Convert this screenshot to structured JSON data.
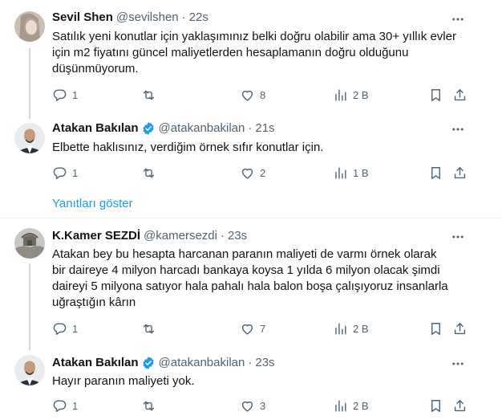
{
  "tweets": [
    {
      "name": "Sevil Shen",
      "handle": "@sevilshen",
      "separator": "·",
      "time": "22s",
      "verified": false,
      "lines": [
        "Satılık yeni konutlar için yaklaşımınız belki doğru olabilir ama 30+ yıllık evler",
        "için m2 fiyatını güncel maliyetlerden hesaplamanın doğru olduğunu",
        "düşünmüyorum."
      ],
      "replies": "1",
      "retweets": "",
      "likes": "8",
      "views": "2 B"
    },
    {
      "name": "Atakan Bakılan",
      "handle": "@atakanbakilan",
      "separator": "·",
      "time": "21s",
      "verified": true,
      "lines": [
        "Elbette haklısınız, verdiğim örnek sıfır konutlar için."
      ],
      "replies": "1",
      "retweets": "",
      "likes": "2",
      "views": "1 B"
    },
    {
      "name": "K.Kamer SEZDİ",
      "handle": "@kamersezdi",
      "separator": "·",
      "time": "23s",
      "verified": false,
      "lines": [
        "Atakan bey bu  hesapta harcanan paranın  maliyeti de varmı örnek olarak",
        "bir daireye 4 milyon harcadı bankaya koysa 1 yılda 6 milyon olacak şimdi",
        "daireyi 5 milyona satıyor hala pahalı hala balon boşa çalışıyoruz insanlarla",
        "uğraştığın kârın"
      ],
      "replies": "1",
      "retweets": "",
      "likes": "7",
      "views": "2 B"
    },
    {
      "name": "Atakan Bakılan",
      "handle": "@atakanbakilan",
      "separator": "·",
      "time": "23s",
      "verified": true,
      "lines": [
        "Hayır paranın maliyeti yok."
      ],
      "replies": "1",
      "retweets": "",
      "likes": "3",
      "views": "2 B"
    }
  ],
  "show_replies_label": "Yanıtları göster",
  "icons": [
    "more-icon",
    "reply-icon",
    "retweet-icon",
    "like-icon",
    "views-icon",
    "bookmark-icon",
    "share-icon",
    "verified-badge-icon"
  ],
  "colors": {
    "text": "#0f1419",
    "secondary": "#536471",
    "accent": "#1d9bf0",
    "divider": "#eff3f4",
    "thread_line": "#cfd9de"
  }
}
